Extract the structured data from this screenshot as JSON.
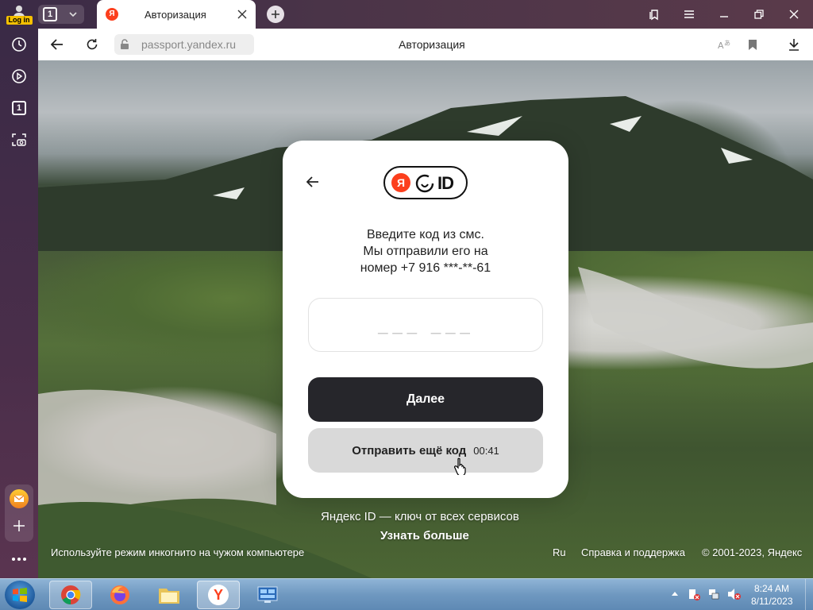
{
  "browser": {
    "login_label": "Log in",
    "tab_counter": "1",
    "active_tab_title": "Авторизация",
    "address": "passport.yandex.ru",
    "page_title": "Авторизация",
    "side_counter": "1"
  },
  "auth": {
    "logo_text": "ID",
    "logo_letter": "Я",
    "instruction_line1": "Введите код из смс.",
    "instruction_line2": "Мы отправили его на",
    "instruction_line3": "номер +7 916 ***-**-61",
    "code_placeholder": "___ ___",
    "next_button": "Далее",
    "resend_button": "Отправить ещё код",
    "resend_timer": "00:41"
  },
  "footer": {
    "tagline": "Яндекс ID — ключ от всех сервисов",
    "learn_more": "Узнать больше",
    "incognito_hint": "Используйте режим инкогнито на чужом компьютере",
    "language": "Ru",
    "help": "Справка и поддержка",
    "copyright": "© 2001-2023, Яндекс"
  },
  "taskbar": {
    "time": "8:24 AM",
    "date": "8/11/2023"
  },
  "colors": {
    "brand_red": "#fc3f1d",
    "button_dark": "#26262b",
    "button_light": "#d9d9d9"
  }
}
